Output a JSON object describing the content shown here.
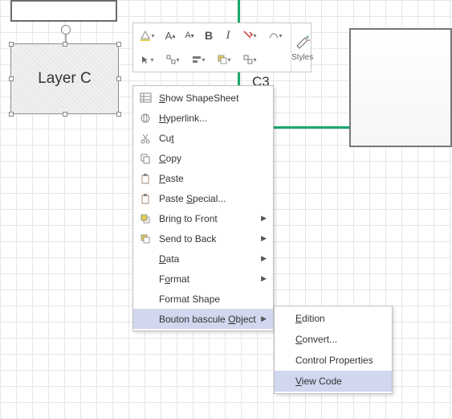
{
  "canvas": {
    "layer_c_text": "Layer C",
    "c3_label": "C3"
  },
  "mini_toolbar": {
    "fill": "Fill",
    "inc_font": "A",
    "dec_font": "A",
    "bold": "B",
    "italic": "I",
    "styles_label": "Styles"
  },
  "menu": {
    "show_shapesheet": "how ShapeSheet",
    "show_shapesheet_u": "S",
    "hyperlink": "yperlink...",
    "hyperlink_u": "H",
    "cut": "Cu",
    "cut_t": "t",
    "copy": "opy",
    "copy_u": "C",
    "paste": "aste",
    "paste_u": "P",
    "paste_special": "Paste ",
    "paste_special_s": "S",
    "paste_special_rest": "pecial...",
    "bring_front": "Bring to Front",
    "send_back": "Send to Back",
    "data": "ata",
    "data_u": "D",
    "format": "F",
    "format_o": "o",
    "format_rest": "rmat",
    "format_shape": "Format Shape",
    "object": "Bouton bascule ",
    "object_o": "O",
    "object_rest": "bject"
  },
  "submenu": {
    "edition": "dition",
    "edition_u": "E",
    "convert": "onvert...",
    "convert_u": "C",
    "control_props": "Control Properties",
    "view_code": "iew Code",
    "view_code_u": "V"
  }
}
